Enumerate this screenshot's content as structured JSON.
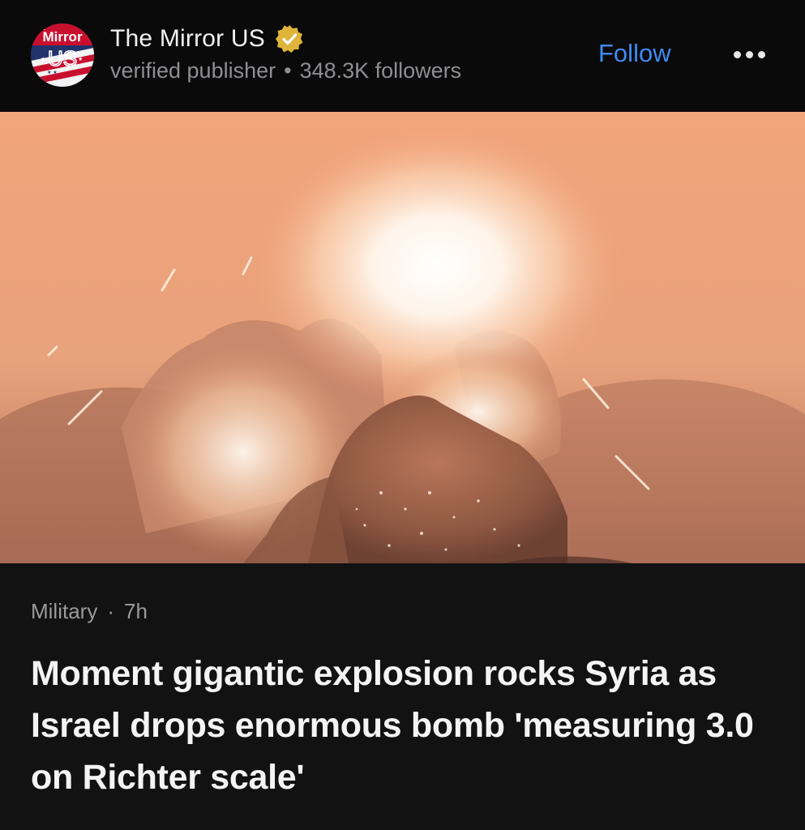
{
  "publisher": {
    "logo_text_top": "Mirror",
    "logo_text_bottom": "US",
    "logo_small_text": "THE",
    "name": "The Mirror US",
    "verified_icon": "verified-badge-icon",
    "verified_color": "#e0b43a",
    "subtitle": "verified publisher",
    "separator": "•",
    "followers": "348.3K followers"
  },
  "actions": {
    "follow_label": "Follow",
    "follow_color": "#3d8bf5",
    "more_icon": "more-dots-icon"
  },
  "article": {
    "category": "Military",
    "separator": "·",
    "time": "7h",
    "headline": "Moment gigantic explosion rocks Syria as Israel drops enormous bomb 'measuring 3.0 on Richter scale'"
  },
  "colors": {
    "background": "#000000",
    "card": "#121212",
    "muted_text": "#8e8e93"
  }
}
